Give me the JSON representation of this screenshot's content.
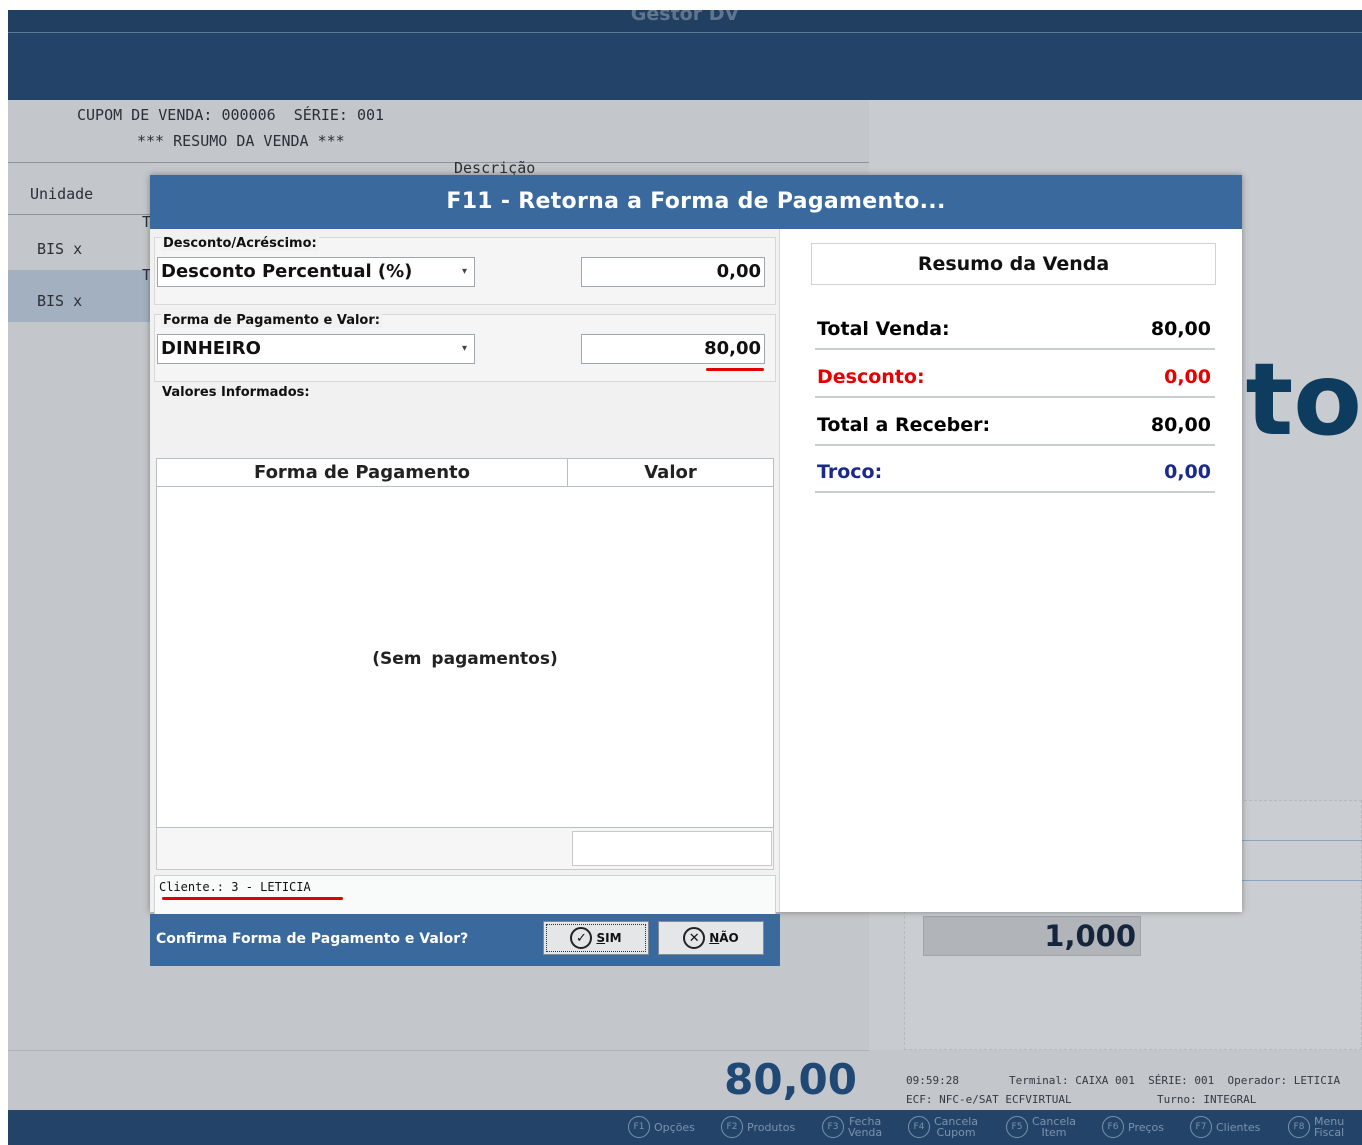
{
  "app": {
    "title": "Gestor DV",
    "receipt": {
      "line1": "CUPOM DE VENDA: 000006  SÉRIE: 001",
      "line2": "*** RESUMO DA VENDA ***",
      "col_descricao": "Descrição",
      "col_unidade": "Unidade",
      "frag_t1": "T",
      "item1": "BIS x",
      "frag_t2": "T",
      "item2": "BIS x"
    },
    "logo_fragment": "to",
    "quantity": "1,000",
    "grand_total": "80,00",
    "status": {
      "time": "09:59:28",
      "terminal": "Terminal: CAIXA 001  SÉRIE: 001  Operador: LETICIA",
      "ecf": "ECF: NFC-e/SAT ECFVIRTUAL",
      "turno": "Turno: INTEGRAL"
    },
    "fkeys": [
      {
        "key": "F1",
        "label": "Opções"
      },
      {
        "key": "F2",
        "label": "Produtos"
      },
      {
        "key": "F3",
        "label": "Fecha\nVenda"
      },
      {
        "key": "F4",
        "label": "Cancela\nCupom"
      },
      {
        "key": "F5",
        "label": "Cancela\nItem"
      },
      {
        "key": "F6",
        "label": "Preços"
      },
      {
        "key": "F7",
        "label": "Clientes"
      },
      {
        "key": "F8",
        "label": "Menu\nFiscal"
      }
    ]
  },
  "dialog": {
    "title": "F11 - Retorna a Forma de Pagamento...",
    "desconto": {
      "legend": "Desconto/Acréscimo:",
      "type": "Desconto Percentual (%)",
      "value": "0,00"
    },
    "pagamento": {
      "legend": "Forma de Pagamento e Valor:",
      "forma": "DINHEIRO",
      "valor": "80,00"
    },
    "valores": {
      "legend": "Valores Informados:",
      "col_forma": "Forma de Pagamento",
      "col_valor": "Valor",
      "empty_text": "(Sem  pagamentos)"
    },
    "cliente": "Cliente.: 3 - LETICIA",
    "confirm_text": "Confirma Forma de Pagamento e Valor?",
    "btn_sim": {
      "mnemonic": "S",
      "rest": "IM"
    },
    "btn_nao": {
      "mnemonic": "N",
      "rest": "ÃO"
    },
    "summary": {
      "title": "Resumo da Venda",
      "total_venda_label": "Total Venda:",
      "total_venda": "80,00",
      "desconto_label": "Desconto:",
      "desconto": "0,00",
      "total_receber_label": "Total a Receber:",
      "total_receber": "80,00",
      "troco_label": "Troco:",
      "troco": "0,00"
    }
  },
  "colors": {
    "header_blue": "#234468",
    "dialog_blue": "#3a6a9d",
    "desconto_red": "#e60000",
    "troco_navy": "#1a2a8c"
  }
}
